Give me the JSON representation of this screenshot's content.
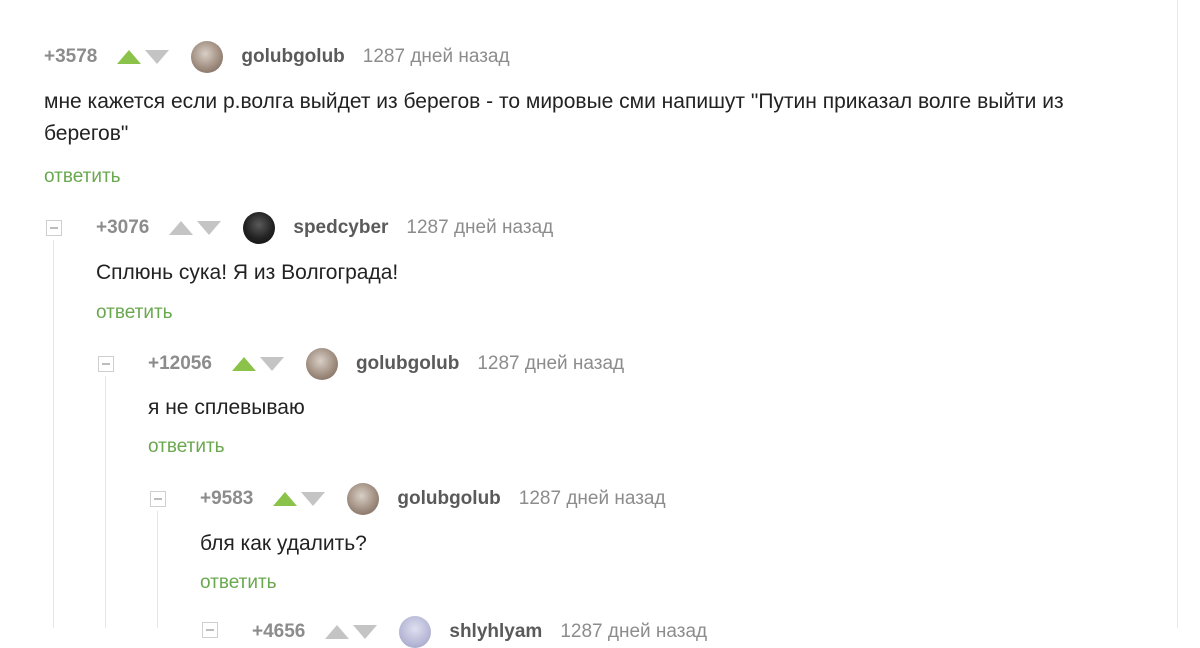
{
  "reply_label": "ответить",
  "comments": [
    {
      "rating": "+3578",
      "vote": "up",
      "username": "golubgolub",
      "time": "1287 дней назад",
      "text": "мне кажется если р.волга выйдет из берегов - то мировые сми напишут \"Путин приказал волге выйти из берегов\""
    },
    {
      "rating": "+3076",
      "vote": "none",
      "username": "spedcyber",
      "time": "1287 дней назад",
      "text": "Сплюнь сука! Я из Волгограда!"
    },
    {
      "rating": "+12056",
      "vote": "up",
      "username": "golubgolub",
      "time": "1287 дней назад",
      "text": "я не сплевываю"
    },
    {
      "rating": "+9583",
      "vote": "up",
      "username": "golubgolub",
      "time": "1287 дней назад",
      "text": "бля как удалить?"
    },
    {
      "rating": "+4656",
      "vote": "none",
      "username": "shlyhlyam",
      "time": "1287 дней назад"
    }
  ],
  "colors": {
    "vote_active": "#8bc34a",
    "reply_link": "#6aa84f",
    "text": "#222222",
    "meta": "#8c8c8c"
  }
}
